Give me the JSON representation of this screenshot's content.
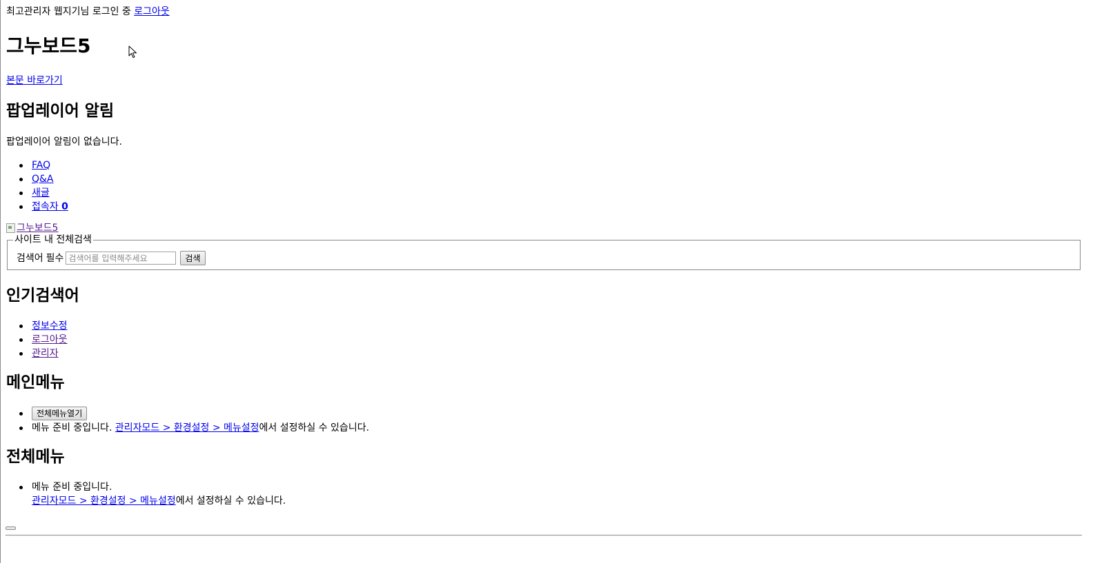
{
  "header": {
    "login_status": "최고관리자 웹지기님 로그인 중",
    "logout_link": "로그아웃",
    "site_title": "그누보드5",
    "skip_link": "본문 바로가기"
  },
  "popup": {
    "heading": "팝업레이어 알림",
    "empty_message": "팝업레이어 알림이 없습니다."
  },
  "quick_links": [
    {
      "label": "FAQ"
    },
    {
      "label": "Q&A"
    },
    {
      "label": "새글"
    },
    {
      "label": "접속자",
      "count": "0"
    }
  ],
  "logo": {
    "alt_text": "그누보드5",
    "icon": "broken-image-icon"
  },
  "search": {
    "legend": "사이트 내 전체검색",
    "field_label": "검색어",
    "required_label": "필수",
    "placeholder": "검색어를 입력해주세요",
    "value": "",
    "submit_label": "검색"
  },
  "popular": {
    "heading": "인기검색어"
  },
  "member_links": [
    {
      "label": "정보수정"
    },
    {
      "label": "로그아웃"
    },
    {
      "label": "관리자"
    }
  ],
  "main_menu": {
    "heading": "메인메뉴",
    "open_all_button": "전체메뉴열기",
    "notice_prefix": "메뉴 준비 중입니다.",
    "notice_link": "관리자모드 > 환경설정 > 메뉴설정",
    "notice_suffix": "에서 설정하실 수 있습니다."
  },
  "all_menu": {
    "heading": "전체메뉴",
    "notice_prefix": "메뉴 준비 중입니다.",
    "notice_link": "관리자모드 > 환경설정 > 메뉴설정",
    "notice_suffix": "에서 설정하실 수 있습니다."
  },
  "colors": {
    "link": "#0000ee",
    "visited_link": "#551a8b",
    "text": "#000000",
    "background": "#ffffff"
  },
  "icons": {
    "cursor": "mouse-pointer-icon",
    "list_bullet": "disc-bullet"
  }
}
